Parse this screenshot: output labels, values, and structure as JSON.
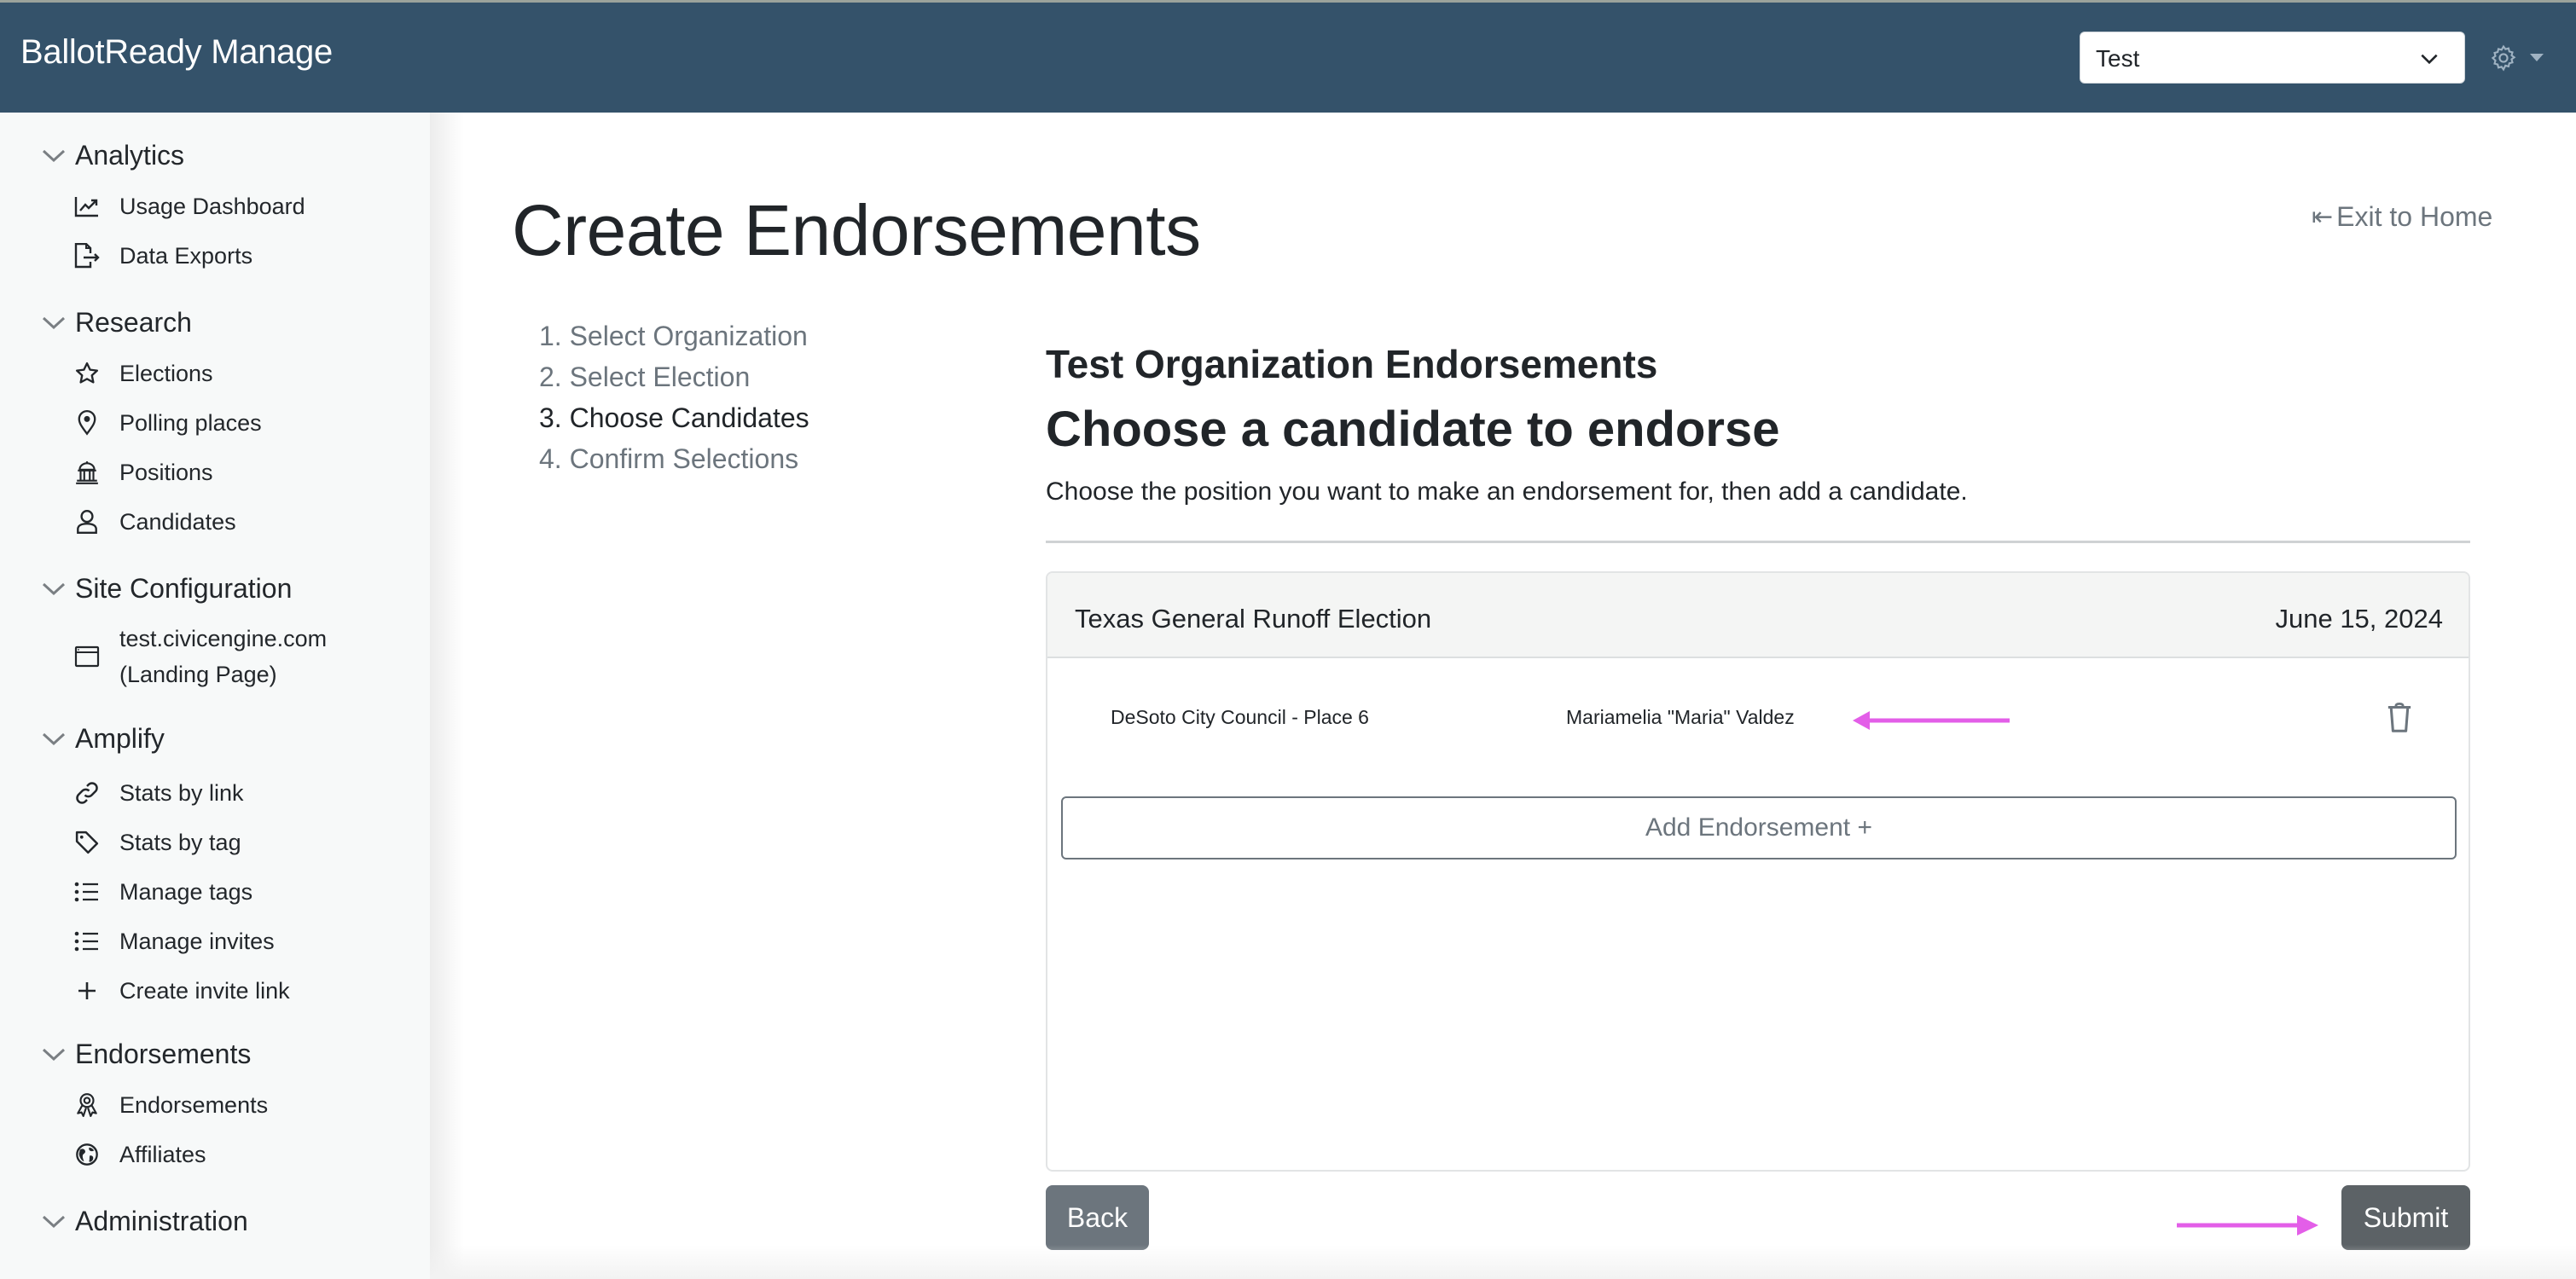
{
  "navbar": {
    "brand": "BallotReady Manage",
    "org_select_value": "Test",
    "settings_icon": "gear-icon"
  },
  "sidebar": {
    "sections": [
      {
        "label": "Analytics",
        "items": [
          {
            "label": "Usage Dashboard",
            "icon": "chart-line-icon"
          },
          {
            "label": "Data Exports",
            "icon": "file-export-icon"
          }
        ]
      },
      {
        "label": "Research",
        "items": [
          {
            "label": "Elections",
            "icon": "star-icon"
          },
          {
            "label": "Polling places",
            "icon": "map-pin-icon"
          },
          {
            "label": "Positions",
            "icon": "capitol-building-icon"
          },
          {
            "label": "Candidates",
            "icon": "person-icon"
          }
        ]
      },
      {
        "label": "Site Configuration",
        "items": [
          {
            "label": "test.civicengine.com",
            "label_line2": "(Landing Page)",
            "icon": "browser-window-icon"
          }
        ]
      },
      {
        "label": "Amplify",
        "items": [
          {
            "label": "Stats by link",
            "icon": "link-icon"
          },
          {
            "label": "Stats by tag",
            "icon": "tag-icon"
          },
          {
            "label": "Manage tags",
            "icon": "list-icon"
          },
          {
            "label": "Manage invites",
            "icon": "list-icon"
          },
          {
            "label": "Create invite link",
            "icon": "plus-icon"
          }
        ]
      },
      {
        "label": "Endorsements",
        "items": [
          {
            "label": "Endorsements",
            "icon": "award-ribbon-icon"
          },
          {
            "label": "Affiliates",
            "icon": "globe-icon"
          }
        ]
      },
      {
        "label": "Administration",
        "items": []
      }
    ]
  },
  "main": {
    "title": "Create Endorsements",
    "exit_link": "Exit to Home",
    "steps": [
      {
        "label": "1. Select Organization",
        "active": false
      },
      {
        "label": "2. Select Election",
        "active": false
      },
      {
        "label": "3. Choose Candidates",
        "active": true
      },
      {
        "label": "4. Confirm Selections",
        "active": false
      }
    ],
    "org_heading": "Test Organization Endorsements",
    "heading": "Choose a candidate to endorse",
    "description": "Choose the position you want to make an endorsement for, then add a candidate.",
    "election": {
      "name": "Texas General Runoff Election",
      "date": "June 15, 2024",
      "endorsements": [
        {
          "position": "DeSoto City Council - Place 6",
          "candidate": "Mariamelia \"Maria\" Valdez"
        }
      ]
    },
    "add_button": "Add Endorsement +",
    "back_button": "Back",
    "submit_button": "Submit",
    "annotation_color": "#e35ee8"
  }
}
